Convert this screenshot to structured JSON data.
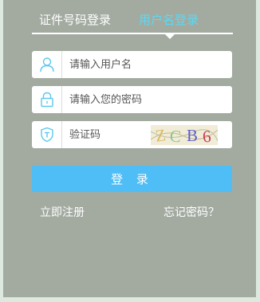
{
  "tabs": {
    "id_login": "证件号码登录",
    "user_login": "用户名登录"
  },
  "form": {
    "username_placeholder": "请输入用户名",
    "password_placeholder": "请输入您的密码",
    "captcha_placeholder": "验证码",
    "captcha_text": "ZCB6"
  },
  "actions": {
    "login": "登 录",
    "register": "立即注册",
    "forgot": "忘记密码？"
  },
  "colors": {
    "active_tab": "#5cd8f3",
    "button": "#4fbdf6",
    "panel": "#a3aba1",
    "icon": "#5cc8ef"
  },
  "icons": {
    "user": "user-icon",
    "password": "lock-icon",
    "captcha": "shield-icon"
  }
}
